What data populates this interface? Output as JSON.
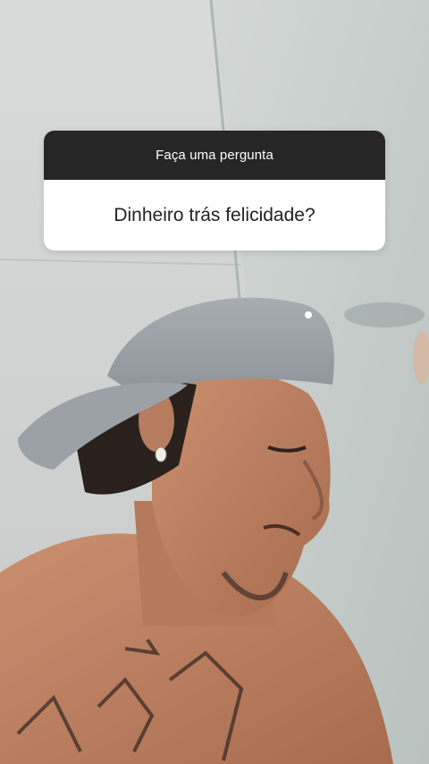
{
  "story": {
    "question_header": "Faça uma pergunta",
    "question_text": "Dinheiro trás felicidade?"
  },
  "colors": {
    "header_bg": "#262626",
    "body_bg": "#ffffff",
    "header_text": "#ffffff",
    "body_text": "#222222"
  },
  "icons": [
    "earring-icon",
    "cap-logo-icon"
  ]
}
